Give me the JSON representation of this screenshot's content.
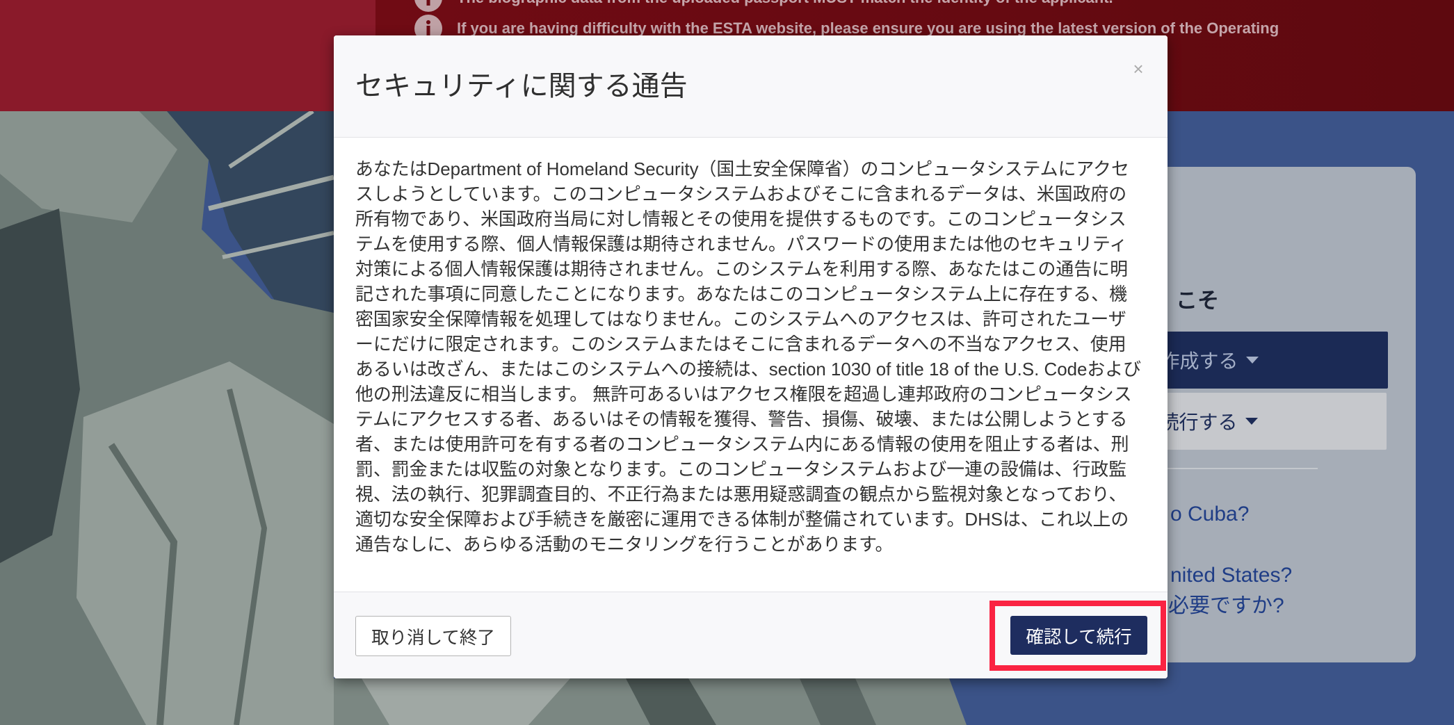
{
  "alert_banner": {
    "icon": "info-icon",
    "messages": [
      "The biographic data from the uploaded passport MUST match the identity of the applicant.",
      "If you are having difficulty with the ESTA website, please ensure you are using the latest version of the Operating"
    ]
  },
  "welcome_panel": {
    "heading": "こそ",
    "primary_button": {
      "label": "作成する",
      "icon": "caret-down-icon"
    },
    "secondary_button": {
      "label": "続行する",
      "icon": "caret-down-icon"
    },
    "links": [
      "o Cuba?",
      "nited States?",
      "必要ですか?"
    ]
  },
  "modal": {
    "title": "セキュリティに関する通告",
    "close_icon": "close-icon",
    "close_glyph": "×",
    "body_lines": [
      "あなたはDepartment of Homeland Security（国土安全保障省）のコンピュータシステムにアクセ",
      "スしようとしています。このコンピュータシステムおよびそこに含まれるデータは、米国政府の",
      "所有物であり、米国政府当局に対し情報とその使用を提供するものです。このコンピュータシス",
      "テムを使用する際、個人情報保護は期待されません。パスワードの使用または他のセキュリティ",
      "対策による個人情報保護は期待されません。このシステムを利用する際、あなたはこの通告に明",
      "記された事項に同意したことになります。あなたはこのコンピュータシステム上に存在する、機",
      "密国家安全保障情報を処理してはなりません。このシステムへのアクセスは、許可されたユーザ",
      "ーにだけに限定されます。このシステムまたはそこに含まれるデータへの不当なアクセス、使用",
      "あるいは改ざん、またはこのシステムへの接続は、section 1030 of title 18 of the U.S. Codeおよび",
      "他の刑法違反に相当します。 無許可あるいはアクセス権限を超過し連邦政府のコンピュータシス",
      "テムにアクセスする者、あるいはその情報を獲得、警告、損傷、破壊、または公開しようとする",
      "者、または使用許可を有する者のコンピュータシステム内にある情報の使用を阻止する者は、刑",
      "罰、罰金または収監の対象となります。このコンピュータシステムおよび一連の設備は、行政監",
      "視、法の執行、犯罪調査目的、不正行為または悪用疑惑調査の観点から監視対象となっており、",
      "適切な安全保障および手続きを厳密に運用できる体制が整備されています。DHSは、これ以上の",
      "通告なしに、あらゆる活動のモニタリングを行うことがあります。"
    ],
    "cancel_button": "取り消して終了",
    "confirm_button": "確認して続行"
  },
  "colors": {
    "header_red": "#8a1a2a",
    "alert_red": "#700b14",
    "page_blue": "#3b5388",
    "modal_primary": "#1e2d5f",
    "highlight": "#fa2342"
  }
}
